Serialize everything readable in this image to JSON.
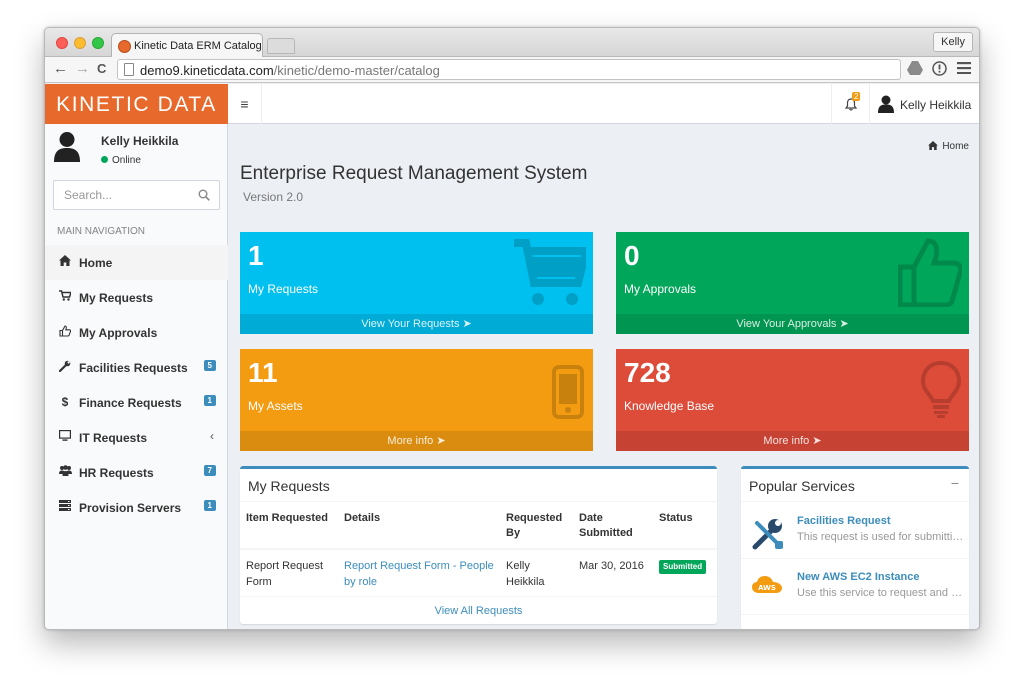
{
  "browser": {
    "tab_title": "Kinetic Data ERM Catalog",
    "tab_close": "×",
    "profile_label": "Kelly",
    "url_host": "demo9.kineticdata.com",
    "url_path": "/kinetic/demo-master/catalog",
    "nav_icons": [
      "back-arrow-icon",
      "forward-arrow-icon",
      "reload-icon"
    ],
    "toolbar_icons": [
      "drive-icon",
      "extension-icon",
      "menu-icon"
    ]
  },
  "header": {
    "logo": "KINETIC DATA",
    "notification_count": "2",
    "user_name": "Kelly Heikkila"
  },
  "sidebar": {
    "user_name": "Kelly Heikkila",
    "status": "Online",
    "search_placeholder": "Search...",
    "nav_header": "MAIN NAVIGATION",
    "items": [
      {
        "label": "Home",
        "icon": "home-icon",
        "glyph": "⌂"
      },
      {
        "label": "My Requests",
        "icon": "cart-icon",
        "glyph": "🛒"
      },
      {
        "label": "My Approvals",
        "icon": "thumbs-up-icon",
        "glyph": "👍"
      },
      {
        "label": "Facilities Requests",
        "icon": "wrench-icon",
        "badge": "5",
        "glyph": "🔧"
      },
      {
        "label": "Finance Requests",
        "icon": "dollar-icon",
        "badge": "1",
        "glyph": "$"
      },
      {
        "label": "IT Requests",
        "icon": "monitor-icon",
        "glyph": "▭"
      },
      {
        "label": "HR Requests",
        "icon": "users-icon",
        "badge": "7",
        "glyph": "👥"
      },
      {
        "label": "Provision Servers",
        "icon": "server-icon",
        "badge": "1",
        "glyph": "≣"
      }
    ]
  },
  "main": {
    "breadcrumb": "Home",
    "title": "Enterprise Request Management System",
    "subtitle": "Version 2.0",
    "stats": [
      {
        "value": "1",
        "label": "My Requests",
        "footer": "View Your Requests",
        "icon": "shopping-cart-icon",
        "color": "#00c0ef"
      },
      {
        "value": "0",
        "label": "My Approvals",
        "footer": "View Your Approvals",
        "icon": "thumbs-up-icon",
        "color": "#00a65a"
      },
      {
        "value": "11",
        "label": "My Assets",
        "footer": "More info",
        "icon": "mobile-phone-icon",
        "color": "#f39c12"
      },
      {
        "value": "728",
        "label": "Knowledge Base",
        "footer": "More info",
        "icon": "lightbulb-icon",
        "color": "#dd4b39"
      }
    ]
  },
  "my_requests": {
    "title": "My Requests",
    "columns": [
      "Item Requested",
      "Details",
      "Requested By",
      "Date Submitted",
      "Status"
    ],
    "rows": [
      {
        "item": "Report Request Form",
        "details": "Report Request Form - People by role",
        "requested_by": "Kelly Heikkila",
        "date": "Mar 30, 2016",
        "status": "Submitted"
      }
    ],
    "footer_link": "View All Requests"
  },
  "popular_services": {
    "title": "Popular Services",
    "collapse": "−",
    "items": [
      {
        "title": "Facilities Request",
        "desc": "This request is used for submitting facilities requests",
        "icon": "tools-icon"
      },
      {
        "title": "New AWS EC2 Instance",
        "desc": "Use this service to request and provision an instance",
        "icon": "aws-cloud-icon"
      }
    ]
  },
  "colors": {
    "brand": "#e8692c",
    "primary": "#3c8dbc",
    "aqua": "#00c0ef",
    "green": "#00a65a",
    "yellow": "#f39c12",
    "red": "#dd4b39"
  }
}
